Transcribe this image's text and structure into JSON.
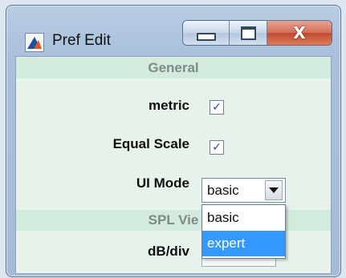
{
  "window": {
    "title": "Pref Edit"
  },
  "titlebar_buttons": {
    "minimize_icon": "minimize-icon",
    "maximize_icon": "maximize-icon",
    "close_glyph": "X"
  },
  "sections": {
    "general": {
      "header": "General"
    },
    "spl": {
      "header": "SPL Vie"
    }
  },
  "fields": {
    "metric": {
      "label": "metric",
      "checked": true,
      "check_glyph": "✓"
    },
    "equal_scale": {
      "label": "Equal Scale",
      "checked": true,
      "check_glyph": "✓"
    },
    "ui_mode": {
      "label": "UI Mode",
      "value": "basic",
      "options": [
        "basic",
        "expert"
      ],
      "highlighted": "expert"
    },
    "db_div": {
      "label": "dB/div"
    }
  },
  "colors": {
    "dropdown_highlight": "#3399ff",
    "panel_bg": "#e6f2ea",
    "header_bg": "#d3ebdd"
  }
}
